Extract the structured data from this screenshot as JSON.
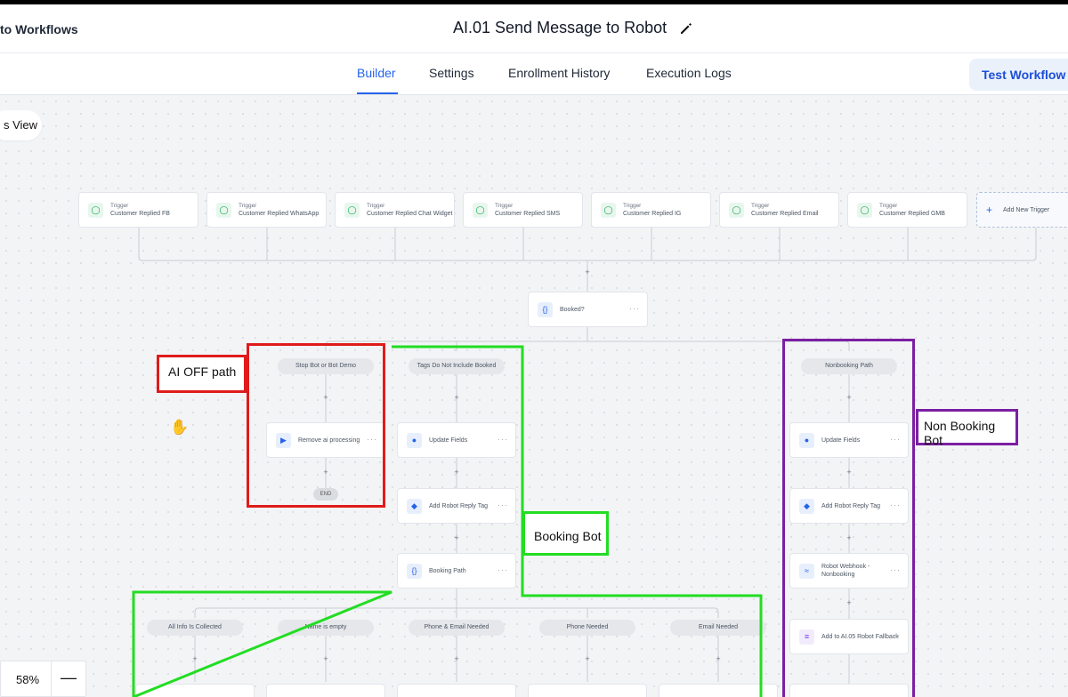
{
  "header": {
    "back_label": "to Workflows",
    "title": "AI.01 Send Message to Robot"
  },
  "tabs": [
    {
      "label": "Builder",
      "active": true
    },
    {
      "label": "Settings",
      "active": false
    },
    {
      "label": "Enrollment History",
      "active": false
    },
    {
      "label": "Execution Logs",
      "active": false
    }
  ],
  "test_button_label": "Test Workflow",
  "view_toggle_label": "s View",
  "triggers": [
    {
      "kind": "Trigger",
      "name": "Customer Replied FB"
    },
    {
      "kind": "Trigger",
      "name": "Customer Replied WhatsApp"
    },
    {
      "kind": "Trigger",
      "name": "Customer Replied Chat Widget"
    },
    {
      "kind": "Trigger",
      "name": "Customer Replied SMS"
    },
    {
      "kind": "Trigger",
      "name": "Customer Replied IG"
    },
    {
      "kind": "Trigger",
      "name": "Customer Replied Email"
    },
    {
      "kind": "Trigger",
      "name": "Customer Replied GMB"
    }
  ],
  "add_trigger_label": "Add New Trigger",
  "condition_node": "Booked?",
  "branches": {
    "stop_bot": "Stop Bot or Bot Demo",
    "tags_not_booked": "Tags Do Not Include Booked",
    "nonbooking": "Nonbooking Path"
  },
  "actions": {
    "remove_ai": "Remove ai processing",
    "update_fields_1": "Update Fields",
    "add_robot_tag_1": "Add Robot Reply Tag",
    "booking_path": "Booking Path",
    "update_fields_2": "Update Fields",
    "add_robot_tag_2": "Add Robot Reply Tag",
    "robot_webhook": "Robot Webhook -",
    "robot_webhook_2": "Nonbooking",
    "add_to_fallback": "Add to AI.05 Robot Fallback"
  },
  "end_label": "END",
  "sub_branches": [
    "All Info Is Collected",
    "Name is empty",
    "Phone & Email Needed",
    "Phone Needed",
    "Email Needed"
  ],
  "annotations": {
    "ai_off": "AI OFF path",
    "booking_bot": "Booking Bot",
    "non_booking_bot": "Non Booking Bot"
  },
  "zoom": "58%",
  "colors": {
    "accent": "#2563eb",
    "red_annotation": "#e01b1b",
    "green_annotation": "#22dd22",
    "purple_annotation": "#7b1fa2"
  }
}
